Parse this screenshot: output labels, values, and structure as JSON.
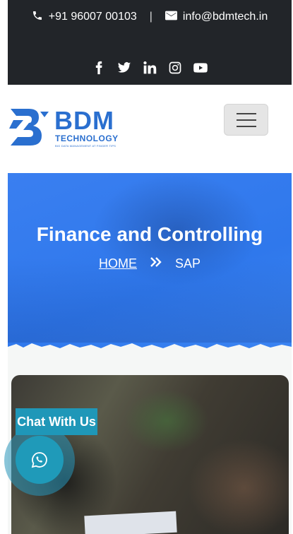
{
  "topbar": {
    "phone": "+91 96007 00103",
    "separator": "|",
    "email": "info@bdmtech.in",
    "social_icons": [
      "facebook-icon",
      "twitter-icon",
      "linkedin-icon",
      "instagram-icon",
      "youtube-icon"
    ]
  },
  "header": {
    "logo_main": "BDM",
    "logo_sub": "TECHNOLOGY",
    "logo_tagline": "BIG DATA MANAGEMENT AT FINGER TIPS",
    "menu_icon": "hamburger-icon"
  },
  "hero": {
    "title": "Finance and Controlling",
    "breadcrumb_home": "HOME",
    "breadcrumb_current": "SAP"
  },
  "chat": {
    "label": "Chat With Us",
    "icon": "whatsapp-icon"
  },
  "colors": {
    "topbar_bg": "#222529",
    "brand_blue": "#2a6fcf",
    "hero_blue": "#3a7ff0",
    "chat_teal": "#1f97b8"
  }
}
